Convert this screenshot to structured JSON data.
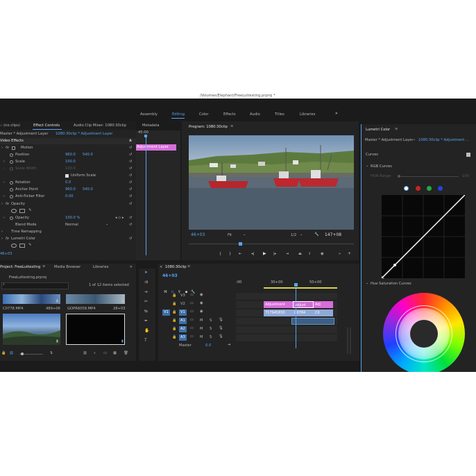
{
  "window_title": "/Volumes/Elephant/FreeLuttesting.prproj *",
  "workspaces": [
    "Assembly",
    "Editing",
    "Color",
    "Effects",
    "Audio",
    "Titles",
    "Libraries"
  ],
  "workspaces_more": "»",
  "effect_panel": {
    "tabs": [
      ":: (no clips)",
      "Effect Controls",
      "Audio Clip Mixer: 1080:30clip",
      "Metadata"
    ],
    "master": "Master * Adjustment Layer",
    "clip": "1080:30clip * Adjustment Layer",
    "section": "Video Effects",
    "motion": "Motion",
    "position_label": "Position",
    "position_x": "960.0",
    "position_y": "540.0",
    "scale_label": "Scale",
    "scale_value": "100.0",
    "scale_width_label": "Scale Width",
    "scale_width_value": "100.0",
    "uniform_scale": "Uniform Scale",
    "rotation_label": "Rotation",
    "rotation_value": "0.0",
    "anchor_label": "Anchor Point",
    "anchor_x": "960.0",
    "anchor_y": "540.0",
    "antiflicker_label": "Anti-flicker Filter",
    "antiflicker_value": "0.00",
    "opacity_section": "Opacity",
    "opacity_label": "Opacity",
    "opacity_value": "100.0 %",
    "blend_label": "Blend Mode",
    "blend_value": "Normal",
    "time_remap": "Time Remapping",
    "lumetri": "Lumetri Color",
    "timecode": "46+03",
    "mini_time": "45:00",
    "mini_clip": "Adjustment Layer"
  },
  "program": {
    "title": "Program: 1080:30clip",
    "timecode": "46+03",
    "fit": "Fit",
    "resolution": "1/2",
    "duration": "147+08"
  },
  "lumetri": {
    "tab": "Lumetri Color",
    "master": "Master * Adjustment Layer",
    "clip": "1080:30clip * Adjustment ...",
    "curves": "Curves",
    "rgb_curves": "RGB Curves",
    "hdr_range": "HDR Range",
    "hdr_value": "100",
    "hue_sat": "Hue Saturation Curves",
    "channel_colors": [
      "#ffffff",
      "#cc2222",
      "#22aa44",
      "#2244dd"
    ]
  },
  "project": {
    "tabs": [
      "Project: FreeLuttesting",
      "Media Browser",
      "Libraries"
    ],
    "file": "FreeLuttesting.prproj",
    "count": "1 of 12 items selected",
    "items": [
      {
        "name": "C0778.MP4",
        "duration": "489+06"
      },
      {
        "name": "GOPR6058.MP4",
        "duration": "28+03"
      }
    ]
  },
  "timeline": {
    "title": "1080:30clip",
    "timecode": "46+03",
    "ruler": [
      "-00",
      "30+00",
      "50+00"
    ],
    "tracks": [
      "V3",
      "V2",
      "V1",
      "A1",
      "A2",
      "A3"
    ],
    "source_v": "V1",
    "source_a": "A1",
    "master_label": "Master",
    "master_value": "0.0",
    "clips": {
      "v2": [
        "Adjustment",
        "Adjust",
        "Adj"
      ],
      "v1": [
        "717945830",
        "C0784",
        "C0"
      ]
    }
  }
}
